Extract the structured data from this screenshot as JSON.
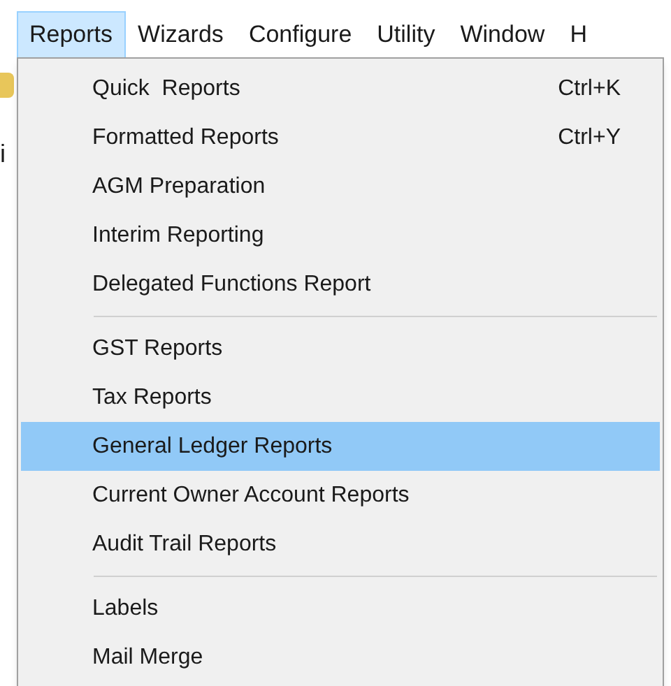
{
  "menu_bar": [
    {
      "label": "Reports",
      "selected": true
    },
    {
      "label": "Wizards",
      "selected": false
    },
    {
      "label": "Configure",
      "selected": false
    },
    {
      "label": "Utility",
      "selected": false
    },
    {
      "label": "Window",
      "selected": false
    },
    {
      "label": "H",
      "selected": false
    }
  ],
  "background_text": "i",
  "dropdown": [
    {
      "kind": "item",
      "label": "Quick  Reports",
      "shortcut": "Ctrl+K",
      "selected": false
    },
    {
      "kind": "item",
      "label": "Formatted Reports",
      "shortcut": "Ctrl+Y",
      "selected": false
    },
    {
      "kind": "item",
      "label": "AGM Preparation",
      "selected": false
    },
    {
      "kind": "item",
      "label": "Interim Reporting",
      "selected": false
    },
    {
      "kind": "item",
      "label": "Delegated Functions Report",
      "selected": false
    },
    {
      "kind": "separator"
    },
    {
      "kind": "item",
      "label": "GST Reports",
      "selected": false
    },
    {
      "kind": "item",
      "label": "Tax Reports",
      "selected": false
    },
    {
      "kind": "item",
      "label": "General Ledger Reports",
      "selected": true
    },
    {
      "kind": "item",
      "label": "Current Owner Account Reports",
      "selected": false
    },
    {
      "kind": "item",
      "label": "Audit Trail Reports",
      "selected": false
    },
    {
      "kind": "separator"
    },
    {
      "kind": "item",
      "label": "Labels",
      "selected": false
    },
    {
      "kind": "item",
      "label": "Mail Merge",
      "selected": false
    }
  ]
}
